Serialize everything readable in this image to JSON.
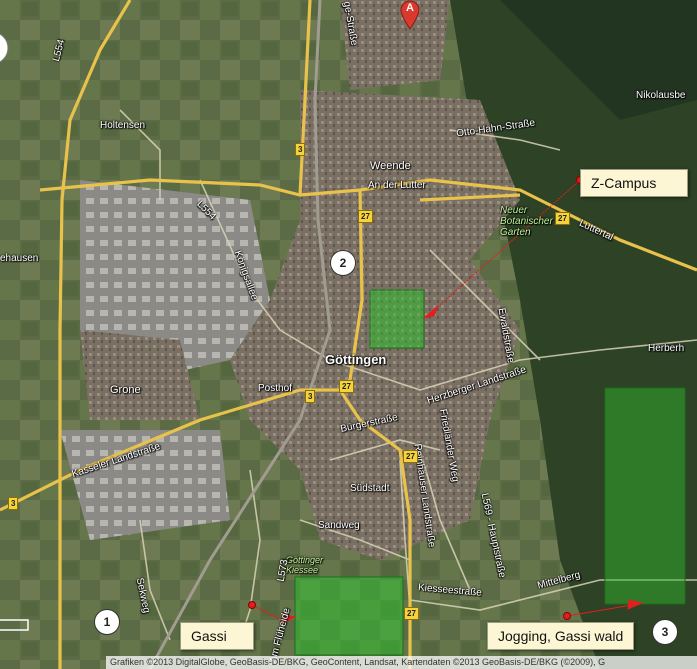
{
  "colors": {
    "road_main": "#e8c24a",
    "road_minor": "#d9d3b8",
    "overlay_green": "#2fbf2f",
    "callout_bg": "#fdf6d4",
    "arrow_red": "#e02020",
    "marker_red": "#d93a2e"
  },
  "marker_a": "A",
  "places": {
    "goettingen": "Göttingen",
    "weende": "Weende",
    "holtensen": "Holtensen",
    "grone": "Grone",
    "suedstadt": "Südstadt",
    "nikolausberg": "Nikolausbe",
    "herberhausen": "Herberh",
    "elliehausen": "ehausen",
    "goettinger_kiesee": "Göttinger Kiessee",
    "neuer_botanischer_garten": "Neuer Botanischer Garten"
  },
  "streets": {
    "otto_hahn": "Otto-Hahn-Straße",
    "an_der_lutter": "An der Lutter",
    "lutterta": "Luttertal",
    "ewaldstrasse": "Ewaldstraße",
    "herzberger": "Herzberger Landstraße",
    "posthof": "Posthof",
    "buergerstrasse": "Bürgerstraße",
    "kasseler": "Kasseler Landstraße",
    "sandweg": "Sandweg",
    "reinhaeuser": "Reinhäuser Landstraße",
    "friedlaender": "Friedländer Weg",
    "hauptstrasse": "L569 - Hauptstraße",
    "kiesseestrasse": "Kiesseestraße",
    "mittelberg": "Mittelberg",
    "sekweg": "Sekweg",
    "koenigsallee": "Königsallee",
    "l554": "L554",
    "l554b": "L554",
    "l573": "L573",
    "ge_strasse": "ge-Straße",
    "am_flueh": "Am Flüheide"
  },
  "shields": [
    "3",
    "3",
    "27",
    "27",
    "27",
    "3",
    "27",
    "27",
    "3"
  ],
  "circles": [
    "1",
    "2",
    "3"
  ],
  "callouts": {
    "z_campus": "Z-Campus",
    "gassi": "Gassi",
    "jogging": "Jogging, Gassi wald"
  },
  "attribution": "Grafiken ©2013 DigitalGlobe, GeoBasis-DE/BKG, GeoContent, Landsat, Kartendaten ©2013 GeoBasis-DE/BKG (©2009), G"
}
